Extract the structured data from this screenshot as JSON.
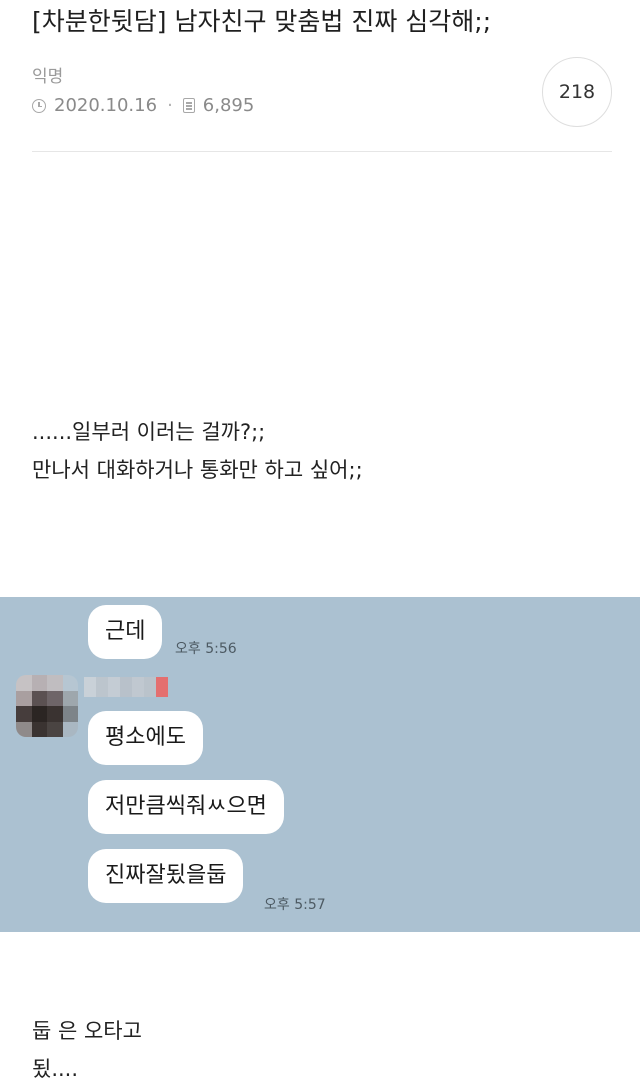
{
  "post": {
    "title": "[차분한뒷담] 남자친구 맞춤법 진짜 심각해;;",
    "author": "익명",
    "date": "2020.10.16",
    "separator": "·",
    "views": "6,895",
    "comment_count": "218"
  },
  "body": {
    "lines": [
      "......일부러 이러는 걸까?;;",
      "만나서 대화하거나 통화만 하고 싶어;;"
    ]
  },
  "chat": {
    "background": "#abc1d1",
    "messages": [
      "근데",
      "평소에도",
      "저만큼씩줘ㅆ으면",
      "진짜잘됬을둡"
    ],
    "times": [
      "오후 5:56",
      "오후 5:57"
    ]
  },
  "footer_text": {
    "lines": [
      "둡 은 오타고",
      "됬...."
    ]
  },
  "icons": {
    "date": "clock-icon",
    "views": "document-icon"
  }
}
